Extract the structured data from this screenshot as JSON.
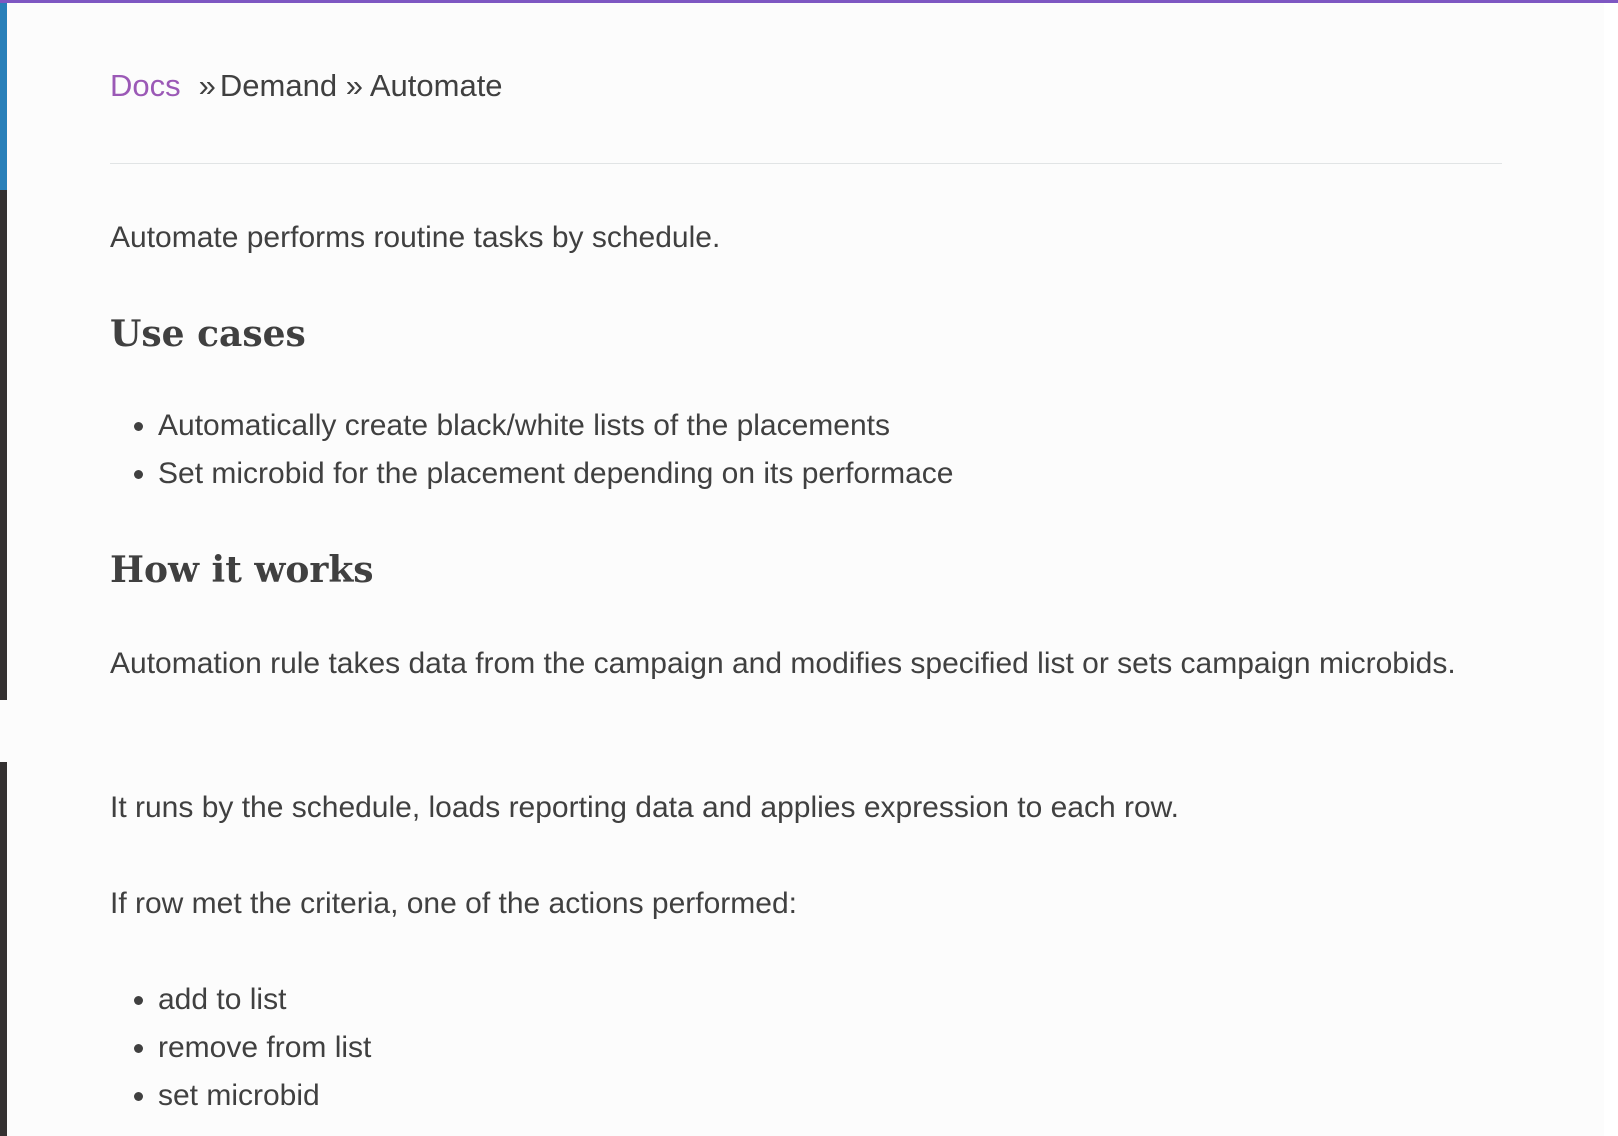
{
  "breadcrumbs": {
    "root": "Docs",
    "sep": "»",
    "items": [
      "Demand",
      "Automate"
    ]
  },
  "intro": "Automate performs routine tasks by schedule.",
  "use_cases": {
    "heading": "Use cases",
    "items": [
      "Automatically create black/white lists of the placements",
      "Set microbid for the placement depending on its performace"
    ]
  },
  "how_it_works": {
    "heading": "How it works",
    "paragraphs": [
      "Automation rule takes data from the campaign and modifies specified list or sets campaign microbids.",
      "It runs by the schedule, loads reporting data and applies expression to each row.",
      "If row met the criteria, one of the actions performed:"
    ],
    "actions": [
      "add to list",
      "remove from list",
      "set microbid"
    ]
  },
  "colors": {
    "link": "#9b59b6",
    "text": "#404040",
    "top_bar": "#7e57c2",
    "sidebar_accent": "#2980b9"
  }
}
